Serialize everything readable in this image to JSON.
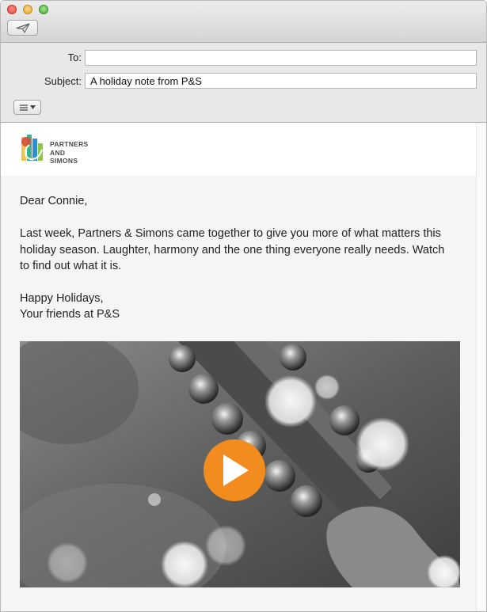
{
  "window": {
    "title_buttons": [
      "close",
      "minimize",
      "zoom"
    ]
  },
  "toolbar": {
    "send_icon": "send-paper-plane-icon"
  },
  "compose": {
    "to_label": "To:",
    "to_value": "",
    "subject_label": "Subject:",
    "subject_value": "A holiday note from P&S",
    "format_icon": "list-format-icon"
  },
  "message": {
    "logo": {
      "line1": "PARTNERS",
      "line2": "AND",
      "line3": "SIMONS",
      "colors": [
        "#f2c14e",
        "#d94a38",
        "#3fae8c",
        "#2f8fcf",
        "#8dc63f"
      ]
    },
    "greeting": "Dear Connie,",
    "paragraph": "Last week, Partners & Simons came together to give you more of what matters this holiday season. Laughter, harmony and the one thing everyone really needs. Watch to find out what it is.",
    "signoff_line1": "Happy Holidays,",
    "signoff_line2": "Your friends at P&S",
    "video": {
      "play_icon": "play-icon",
      "play_color": "#f28c1e"
    }
  }
}
